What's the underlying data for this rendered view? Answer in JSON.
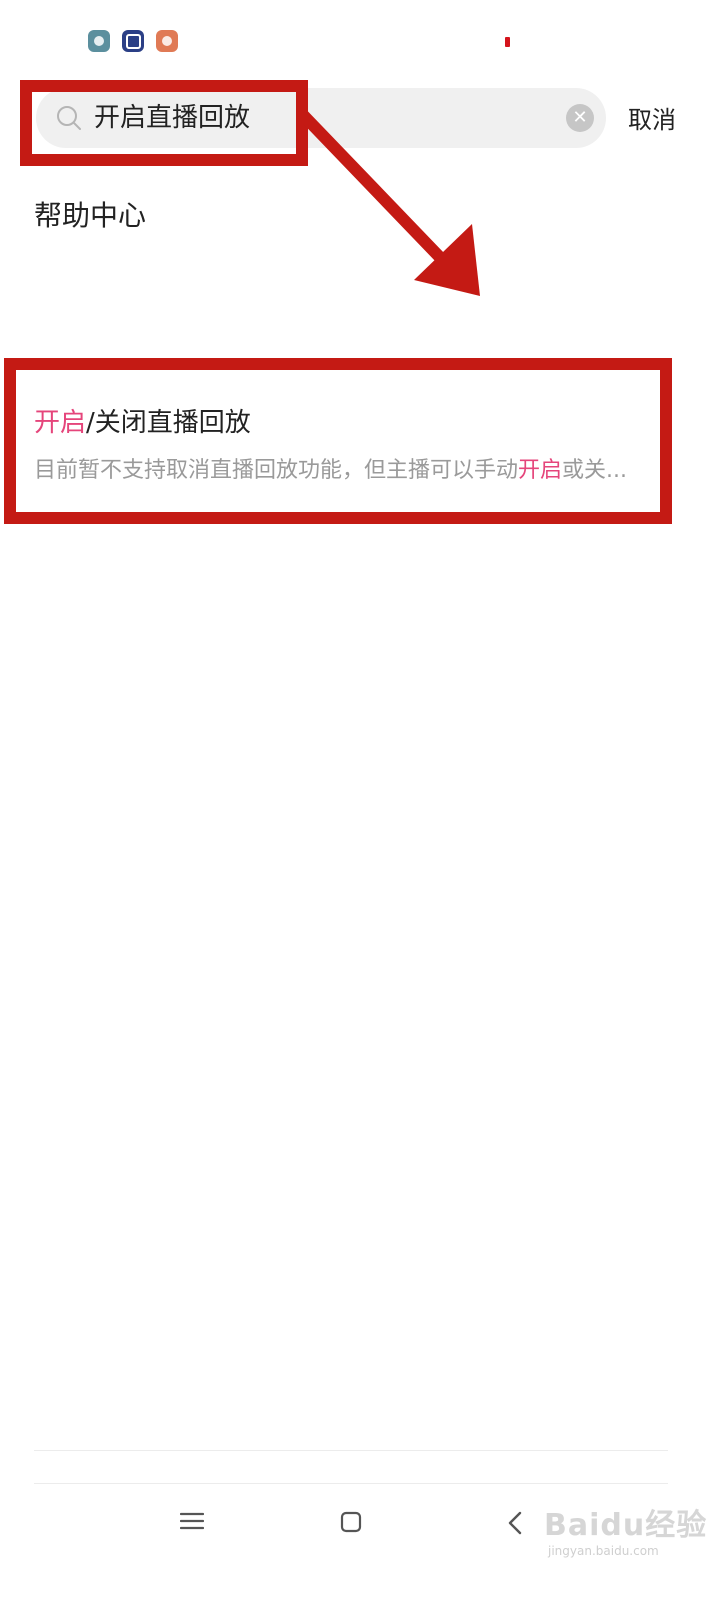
{
  "status_bar": {
    "icons": [
      "app-icon-teal",
      "app-icon-navy",
      "app-icon-orange"
    ]
  },
  "search": {
    "query": "开启直播回放",
    "cancel_label": "取消"
  },
  "section": {
    "title": "帮助中心"
  },
  "result": {
    "title_highlight": "开启",
    "title_rest": "/关闭直播回放",
    "desc_before": "目前暂不支持取消直播回放功能，但主播可以手动",
    "desc_highlight": "开启",
    "desc_after": "或关..."
  },
  "watermark": {
    "brand": "Baidu经验",
    "url": "jingyan.baidu.com"
  },
  "colors": {
    "highlight": "#e5457b",
    "annotation": "#c41a14",
    "search_bg": "#f0f0f0"
  }
}
